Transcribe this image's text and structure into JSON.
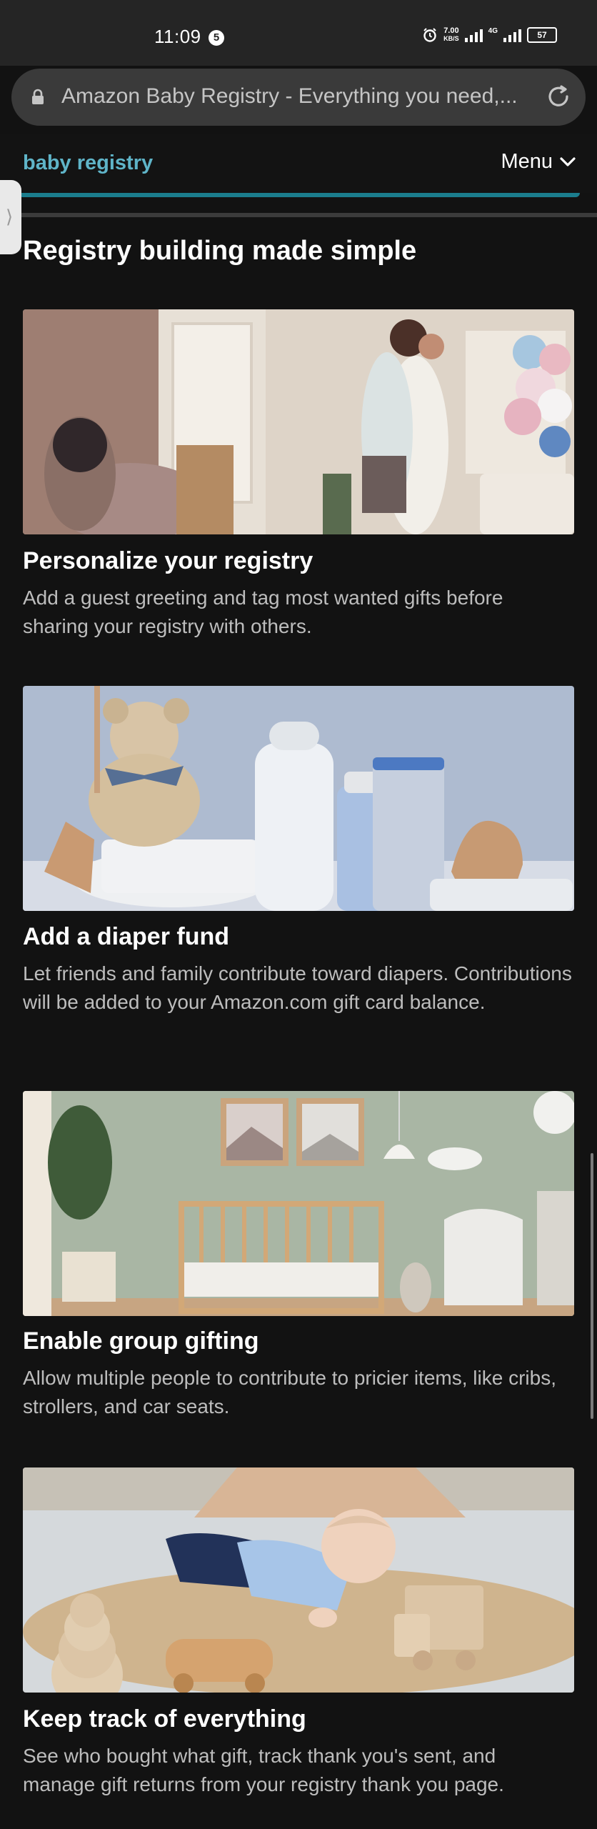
{
  "status_bar": {
    "time": "11:09",
    "notification_count": "5",
    "net_speed_value": "7.00",
    "net_speed_unit": "KB/S",
    "network_type": "4G",
    "battery": "57"
  },
  "url_bar": {
    "text": "Amazon Baby Registry - Everything you need,..."
  },
  "header": {
    "brand": "baby registry",
    "menu_label": "Menu"
  },
  "main": {
    "section_title": "Registry building made simple",
    "features": [
      {
        "title": "Personalize your registry",
        "description": "Add a guest greeting and tag most wanted gifts before sharing your registry with others."
      },
      {
        "title": "Add a diaper fund",
        "description": "Let friends and family contribute toward diapers. Contributions will be added to your Amazon.com gift card balance."
      },
      {
        "title": "Enable group gifting",
        "description": "Allow multiple people to contribute to pricier items, like cribs, strollers, and car seats."
      },
      {
        "title": "Keep track of everything",
        "description": "See who bought what gift, track thank you's sent, and manage gift returns from your registry thank you page."
      }
    ]
  },
  "colors": {
    "background": "#121212",
    "brand_accent": "#5fb4c8",
    "tab_accent": "#1b7d8d",
    "description_text": "#bdbdbd"
  },
  "icons": [
    "lock-icon",
    "reload-icon",
    "chevron-down-icon",
    "alarm-icon",
    "signal-icon",
    "battery-icon"
  ]
}
